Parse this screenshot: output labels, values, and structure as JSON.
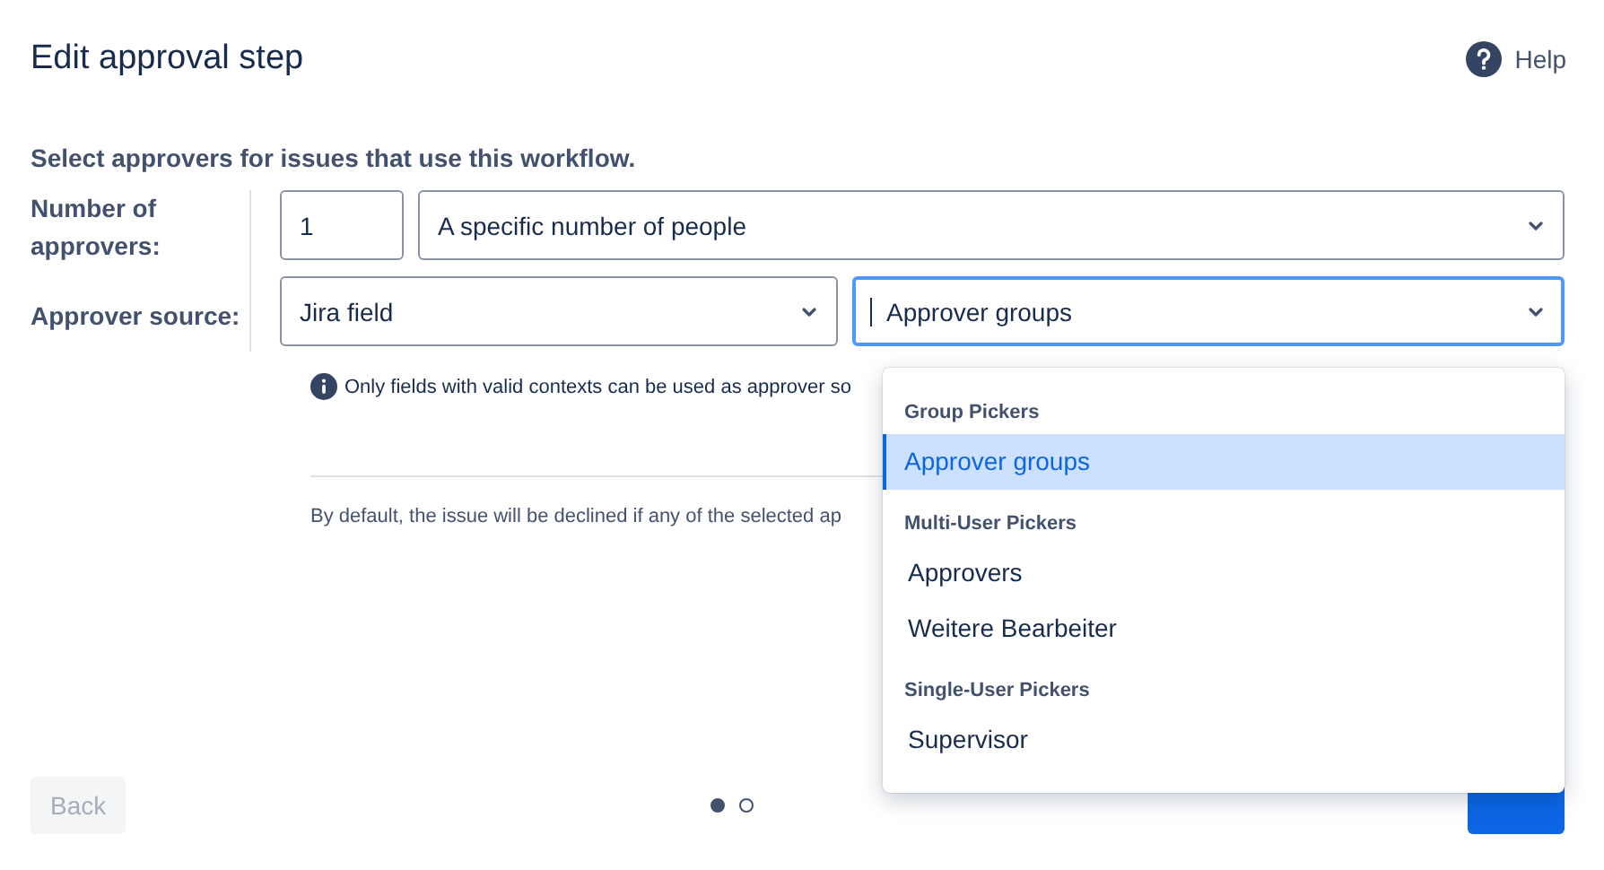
{
  "title": "Edit approval step",
  "help": {
    "label": "Help"
  },
  "intro": "Select approvers for issues that use this workflow.",
  "rows": [
    {
      "label": "Number of approvers:",
      "fields": [
        {
          "kind": "input",
          "value": "1",
          "focused": false
        },
        {
          "kind": "select",
          "value": "A specific number of people",
          "focused": false
        }
      ]
    },
    {
      "label": "Approver source:",
      "fields": [
        {
          "kind": "select",
          "value": "Jira field",
          "focused": false
        },
        {
          "kind": "select",
          "value": "Approver groups",
          "focused": true
        }
      ]
    }
  ],
  "info": "Only fields with valid contexts can be used as approver so",
  "note": "By default, the issue will be declined if any of the selected ap",
  "dropdown": {
    "groups": [
      {
        "heading": "Group Pickers",
        "options": [
          {
            "label": "Approver groups",
            "selected": true
          }
        ]
      },
      {
        "heading": "Multi-User Pickers",
        "options": [
          {
            "label": "Approvers",
            "selected": false
          },
          {
            "label": "Weitere Bearbeiter",
            "selected": false
          }
        ]
      },
      {
        "heading": "Single-User Pickers",
        "options": [
          {
            "label": "Supervisor",
            "selected": false
          }
        ]
      }
    ]
  },
  "footer": {
    "back": {
      "label": "Back",
      "disabled": true
    },
    "pagination": [
      {
        "selected": true
      },
      {
        "selected": false
      }
    ]
  }
}
